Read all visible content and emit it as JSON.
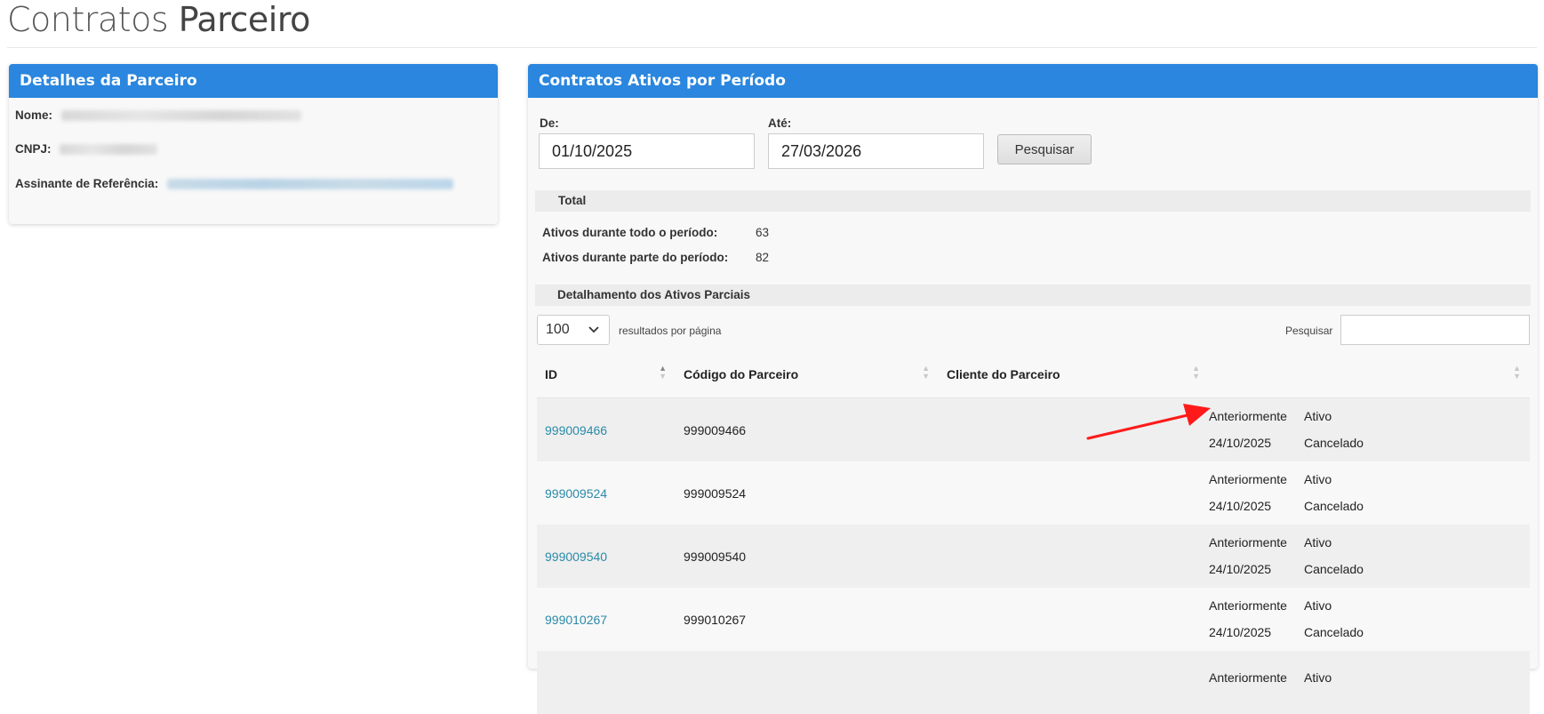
{
  "page": {
    "title_light": "Contratos",
    "title_strong": "Parceiro"
  },
  "left_panel": {
    "title": "Detalhes da Parceiro",
    "fields": [
      {
        "label": "Nome:"
      },
      {
        "label": "CNPJ:"
      },
      {
        "label": "Assinante de Referência:"
      }
    ]
  },
  "right_panel": {
    "title": "Contratos Ativos por Período",
    "filters": {
      "from_label": "De:",
      "from_value": "01/10/2025",
      "to_label": "Até:",
      "to_value": "27/03/2026",
      "search_button": "Pesquisar"
    },
    "total": {
      "heading": "Total",
      "rows": [
        {
          "label": "Ativos durante todo o período:",
          "value": "63"
        },
        {
          "label": "Ativos durante parte do período:",
          "value": "82"
        }
      ]
    },
    "detail_heading": "Detalhamento dos Ativos Parciais",
    "table_controls": {
      "page_size": "100",
      "page_size_label": "resultados por página",
      "search_label": "Pesquisar"
    },
    "columns": [
      "ID",
      "Código do Parceiro",
      "Cliente do Parceiro",
      ""
    ],
    "rows": [
      {
        "id": "999009466",
        "code": "999009466",
        "client": "",
        "s1": "Anteriormente",
        "s2": "Ativo",
        "s3": "24/10/2025",
        "s4": "Cancelado"
      },
      {
        "id": "999009524",
        "code": "999009524",
        "client": "",
        "s1": "Anteriormente",
        "s2": "Ativo",
        "s3": "24/10/2025",
        "s4": "Cancelado"
      },
      {
        "id": "999009540",
        "code": "999009540",
        "client": "",
        "s1": "Anteriormente",
        "s2": "Ativo",
        "s3": "24/10/2025",
        "s4": "Cancelado"
      },
      {
        "id": "999010267",
        "code": "999010267",
        "client": "",
        "s1": "Anteriormente",
        "s2": "Ativo",
        "s3": "24/10/2025",
        "s4": "Cancelado"
      },
      {
        "id": "",
        "code": "",
        "client": "",
        "s1": "Anteriormente",
        "s2": "Ativo",
        "s3": "",
        "s4": ""
      }
    ]
  },
  "colors": {
    "header_blue": "#2a86de",
    "link": "#2a8aa8",
    "annotation_arrow": "#ff1a1a"
  },
  "icons": {
    "select_chevron": "chevron-down-icon",
    "sort": "sort-arrows-icon",
    "annotation": "red-arrow-icon"
  }
}
